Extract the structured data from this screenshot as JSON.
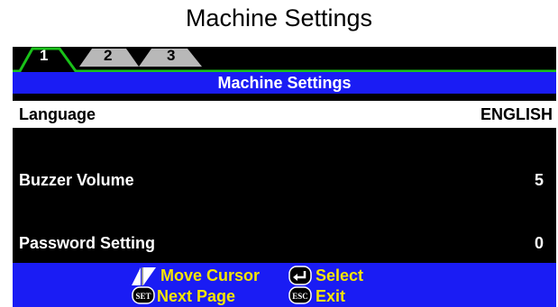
{
  "page_title": "Machine Settings",
  "tabs": [
    {
      "label": "1",
      "active": true
    },
    {
      "label": "2",
      "active": false
    },
    {
      "label": "3",
      "active": false
    }
  ],
  "screen_title": "Machine Settings",
  "settings": [
    {
      "label": "Language",
      "value": "ENGLISH",
      "selected": true
    },
    {
      "label": "Buzzer Volume",
      "value": "5",
      "selected": false
    },
    {
      "label": "Password Setting",
      "value": "0",
      "selected": false
    }
  ],
  "footer": {
    "move_cursor": "Move Cursor",
    "select": "Select",
    "next_page": "Next Page",
    "exit": "Exit",
    "set_key": "SET",
    "esc_key": "ESC"
  },
  "colors": {
    "screen_bg": "#000000",
    "bar_blue": "#1a1cf4",
    "tab_green": "#19c119",
    "tab_inactive": "#b8b8b8",
    "footer_text": "#f5e500"
  }
}
